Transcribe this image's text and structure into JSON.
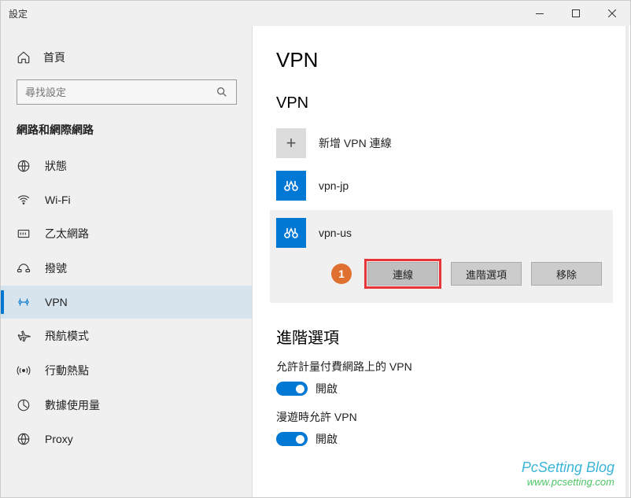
{
  "window": {
    "title": "設定"
  },
  "sidebar": {
    "home": "首頁",
    "searchPlaceholder": "尋找設定",
    "category": "網路和網際網路",
    "items": [
      {
        "label": "狀態"
      },
      {
        "label": "Wi-Fi"
      },
      {
        "label": "乙太網路"
      },
      {
        "label": "撥號"
      },
      {
        "label": "VPN"
      },
      {
        "label": "飛航模式"
      },
      {
        "label": "行動熱點"
      },
      {
        "label": "數據使用量"
      },
      {
        "label": "Proxy"
      }
    ]
  },
  "page": {
    "title": "VPN",
    "section": "VPN",
    "add": "新增 VPN 連線",
    "connections": [
      {
        "name": "vpn-jp"
      },
      {
        "name": "vpn-us"
      }
    ],
    "actions": {
      "connect": "連線",
      "advanced": "進階選項",
      "remove": "移除"
    },
    "step": "1",
    "advancedTitle": "進階選項",
    "settings": [
      {
        "label": "允許計量付費網路上的 VPN",
        "state": "開啟"
      },
      {
        "label": "漫遊時允許 VPN",
        "state": "開啟"
      }
    ]
  },
  "watermark": {
    "line1": "PcSetting Blog",
    "line2": "www.pcsetting.com"
  }
}
